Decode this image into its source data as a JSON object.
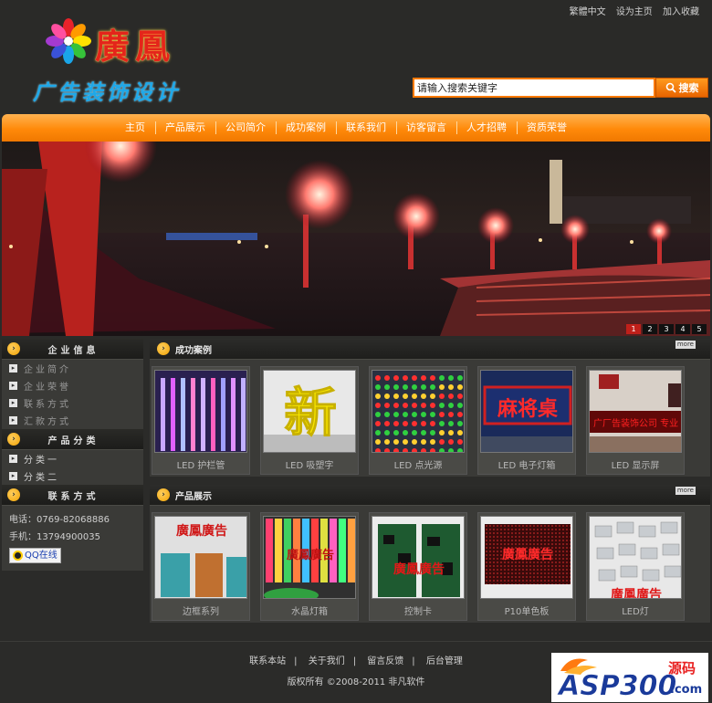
{
  "top_links": [
    "繁體中文",
    "设为主页",
    "加入收藏"
  ],
  "logo": {
    "name": "廣鳳",
    "subtitle": "广告装饰设计"
  },
  "search": {
    "value": "请输入搜索关键字",
    "button": "搜索"
  },
  "nav": [
    "主页",
    "产品展示",
    "公司简介",
    "成功案例",
    "联系我们",
    "访客留言",
    "人才招聘",
    "资质荣誉"
  ],
  "banner": {
    "pages": [
      "1",
      "2",
      "3",
      "4",
      "5"
    ],
    "active_page": "1"
  },
  "sidebar": {
    "company_title": "企业信息",
    "company_items": [
      "企业简介",
      "企业荣誉",
      "联系方式",
      "汇款方式"
    ],
    "category_title": "产品分类",
    "category_items": [
      "分类一",
      "分类二"
    ],
    "contact_title": "联系方式",
    "phone": "电话：0769-82068886",
    "mobile": "手机：13794900035",
    "qq": "QQ在线"
  },
  "cases": {
    "title": "成功案例",
    "more": "more",
    "items": [
      "LED 护栏管",
      "LED 吸塑字",
      "LED 点光源",
      "LED 电子灯箱",
      "LED 显示屏"
    ],
    "thumb_text": {
      "xin": "新",
      "majiang": "麻将桌",
      "ad": "广厂告装饰公司 专业"
    }
  },
  "products": {
    "title": "产品展示",
    "more": "more",
    "items": [
      "边框系列",
      "水晶灯箱",
      "控制卡",
      "P10单色板",
      "LED灯"
    ],
    "thumb_text": "廣鳳廣告"
  },
  "footer": {
    "links": [
      "联系本站",
      "关于我们",
      "留言反馈",
      "后台管理"
    ],
    "copyright": "版权所有 ©2008-2011 非凡软件"
  },
  "watermark": {
    "brand": "ASP300",
    "suffix": "源码",
    "domain": ".com"
  },
  "colors": {
    "accent": "#ff8a0a",
    "background": "#2b2b29",
    "panel": "#3a3a37"
  }
}
